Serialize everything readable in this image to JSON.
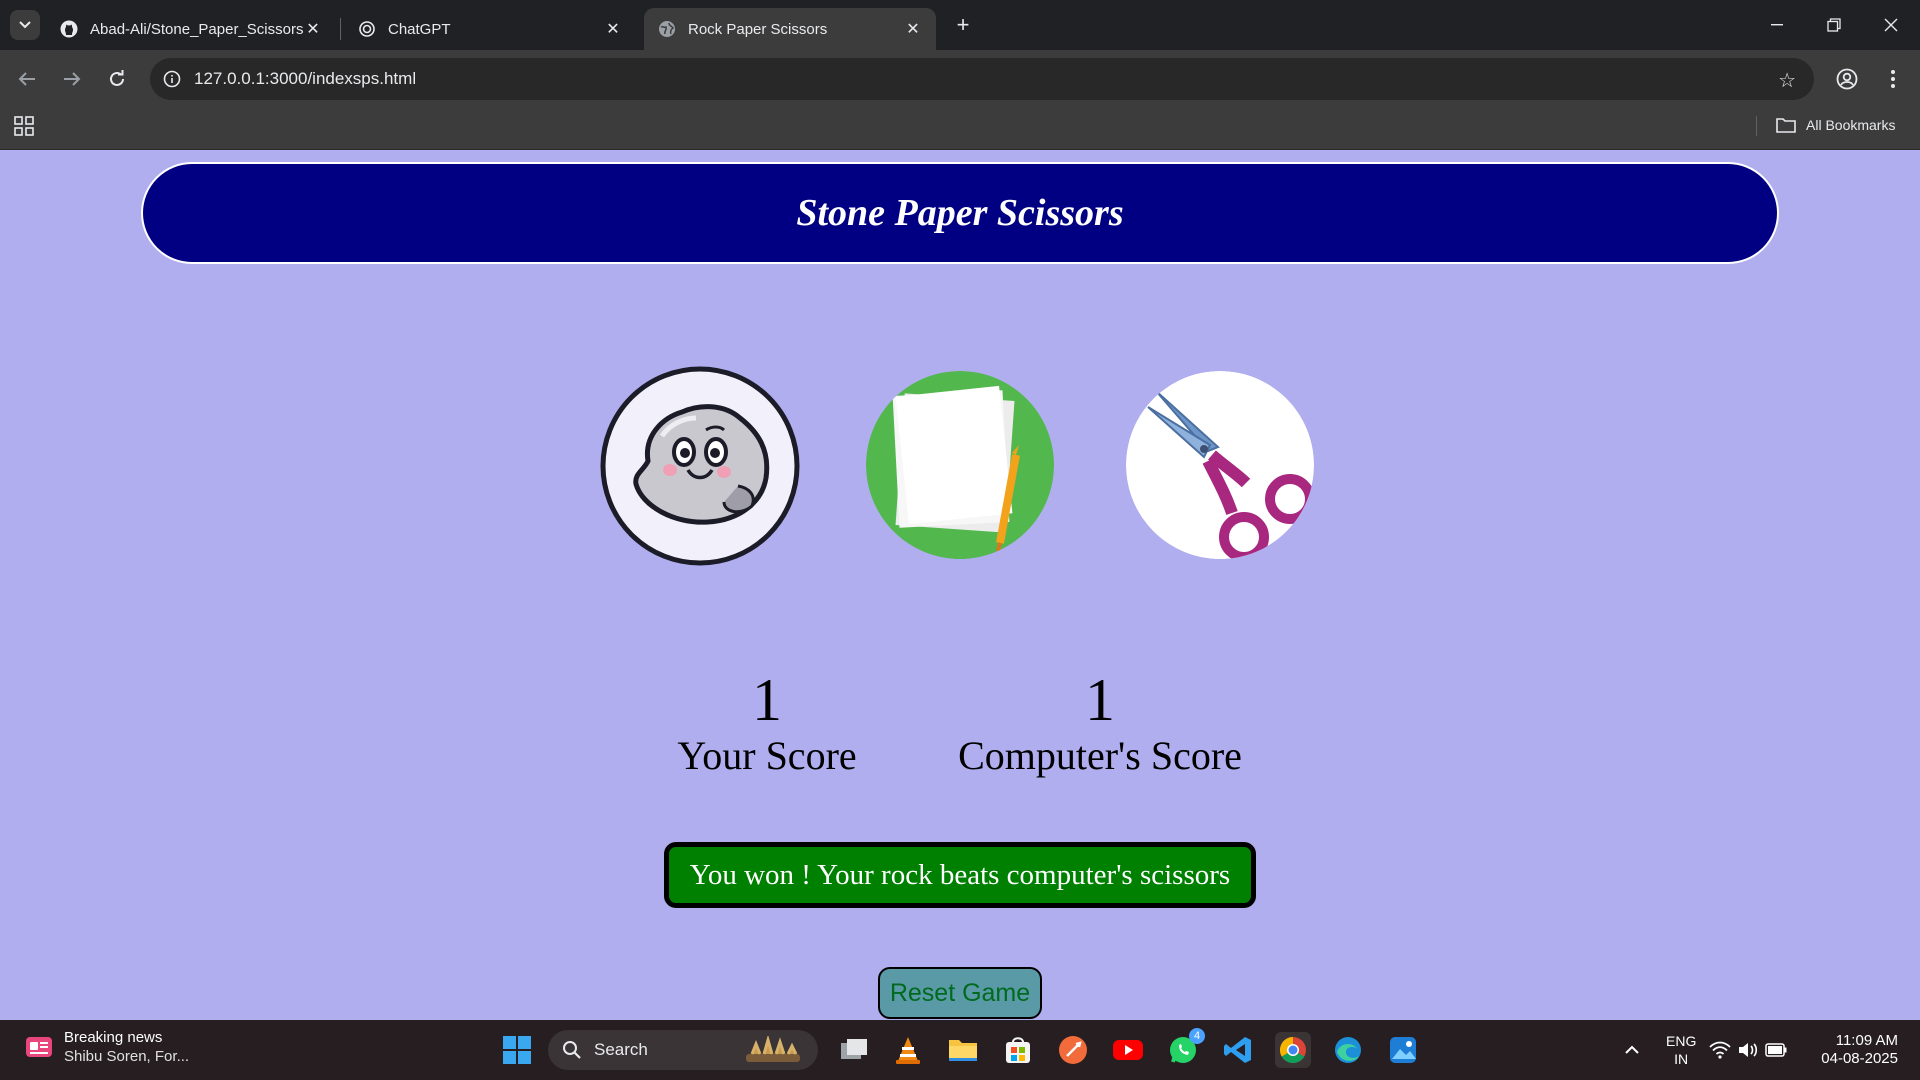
{
  "browser": {
    "tabs": [
      {
        "title": "Abad-Ali/Stone_Paper_Scissors:",
        "favicon": "github-icon"
      },
      {
        "title": "ChatGPT",
        "favicon": "chatgpt-icon"
      },
      {
        "title": "Rock Paper Scissors",
        "favicon": "globe-icon",
        "active": true
      }
    ],
    "url": "127.0.0.1:3000/indexsps.html",
    "bookmarks_label": "All Bookmarks"
  },
  "game": {
    "title": "Stone Paper Scissors",
    "choices": [
      {
        "id": "rock",
        "icon": "rock-icon"
      },
      {
        "id": "paper",
        "icon": "paper-icon"
      },
      {
        "id": "scissors",
        "icon": "scissors-icon"
      }
    ],
    "user_score": "1",
    "user_score_label": "Your Score",
    "comp_score": "1",
    "comp_score_label": "Computer's Score",
    "message": "You won ! Your rock beats computer's scissors",
    "reset_label": "Reset Game",
    "colors": {
      "background": "#b0aeee",
      "header": "#010082",
      "message_bg": "#008001",
      "reset_bg": "#5a9aa6"
    }
  },
  "taskbar": {
    "news_title": "Breaking news",
    "news_subtitle": "Shibu Soren, For...",
    "search_placeholder": "Search",
    "whatsapp_badge": "4",
    "lang_line1": "ENG",
    "lang_line2": "IN",
    "time": "11:09 AM",
    "date": "04-08-2025"
  }
}
